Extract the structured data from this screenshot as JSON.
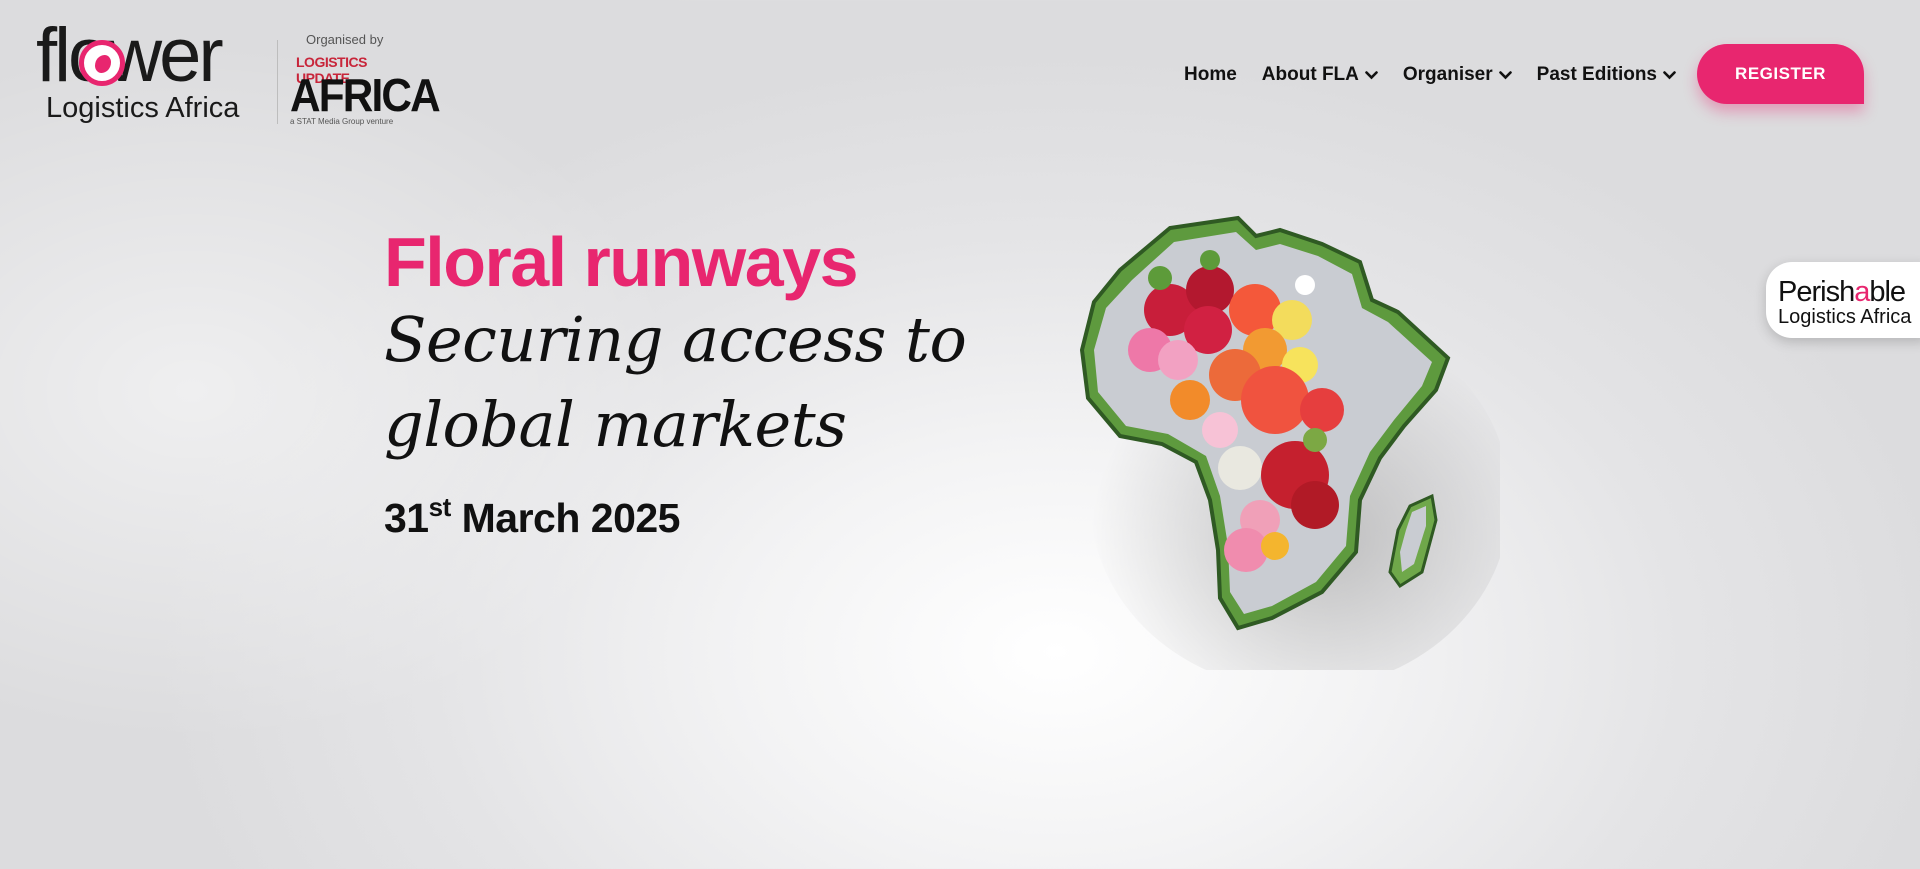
{
  "brand": {
    "logo_word": "flower",
    "logo_sub": "Logistics Africa",
    "organised_by": "Organised by",
    "organiser_top": "LOGISTICS UPDATE",
    "organiser_main": "AFRICA",
    "organiser_tagline": "a STAT Media Group venture"
  },
  "nav": {
    "items": [
      {
        "label": "Home",
        "has_dropdown": false
      },
      {
        "label": "About FLA",
        "has_dropdown": true
      },
      {
        "label": "Organiser",
        "has_dropdown": true
      },
      {
        "label": "Past Editions",
        "has_dropdown": true
      }
    ],
    "register_label": "REGISTER"
  },
  "hero": {
    "title": "Floral runways",
    "line1": "Securing access to",
    "line2": "global markets",
    "date_day": "31",
    "date_suffix": "st",
    "date_rest": " March 2025"
  },
  "side_badge": {
    "line1_a": "Perish",
    "line1_b": "a",
    "line1_c": "ble",
    "line2": "Logistics Africa"
  },
  "colors": {
    "accent": "#e8266f",
    "text": "#111111",
    "tray_green": "#6fa84a"
  }
}
